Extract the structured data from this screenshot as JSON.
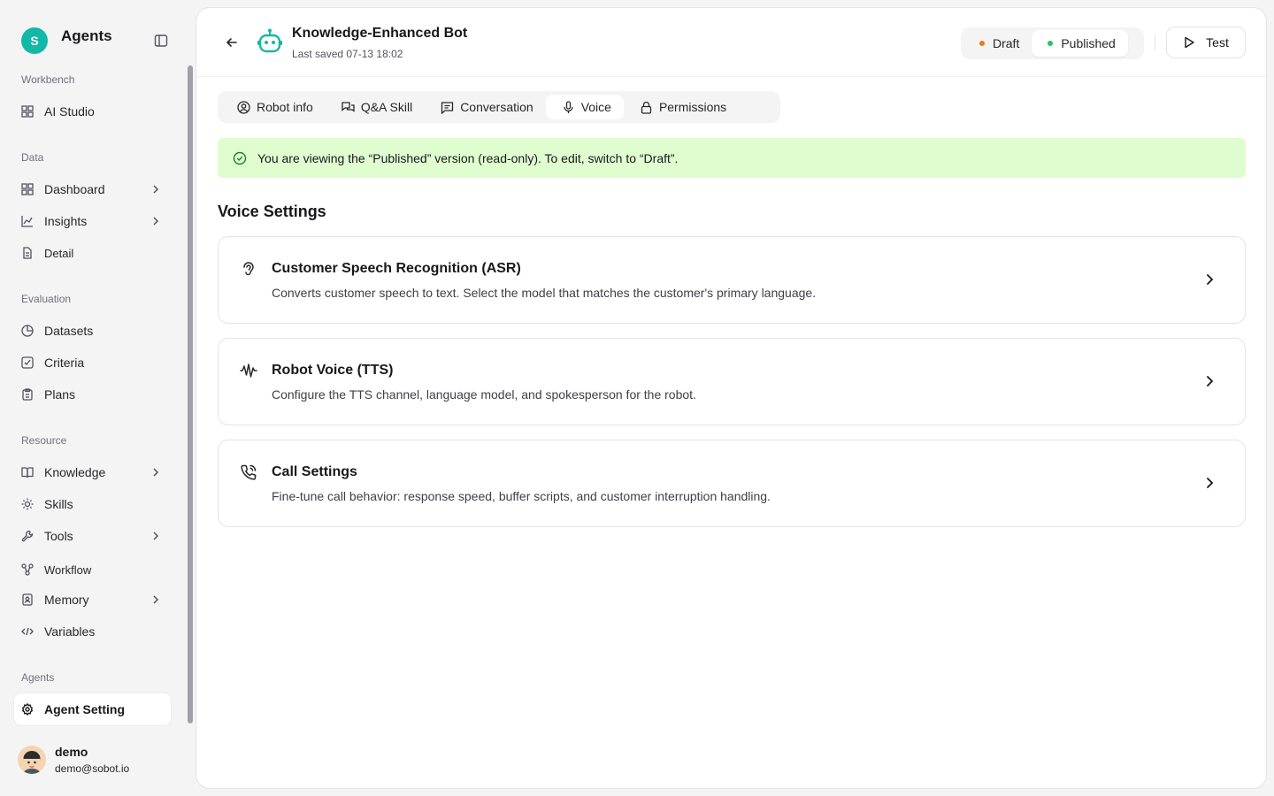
{
  "sidebar": {
    "brand_initial": "S",
    "brand_title": "Agents",
    "sections": {
      "workbench": "Workbench",
      "data": "Data",
      "evaluation": "Evaluation",
      "resource": "Resource",
      "agents": "Agents"
    },
    "items": {
      "ai_studio": "AI Studio",
      "dashboard": "Dashboard",
      "insights": "Insights",
      "detail": "Detail",
      "datasets": "Datasets",
      "criteria": "Criteria",
      "plans": "Plans",
      "knowledge": "Knowledge",
      "skills": "Skills",
      "tools": "Tools",
      "workflow": "Workflow",
      "memory": "Memory",
      "variables": "Variables",
      "agent_setting": "Agent Setting"
    },
    "user": {
      "name": "demo",
      "email": "demo@sobot.io"
    }
  },
  "header": {
    "title": "Knowledge-Enhanced Bot",
    "last_saved": "Last saved 07-13 18:02",
    "versions": [
      {
        "label": "Draft",
        "color": "#f97316"
      },
      {
        "label": "Published",
        "color": "#22c55e"
      }
    ],
    "selected_version": "Published",
    "test_label": "Test"
  },
  "tabs": [
    {
      "label": "Robot info",
      "icon": "user-circle-icon"
    },
    {
      "label": "Q&A Skill",
      "icon": "chat-bubbles-icon"
    },
    {
      "label": "Conversation",
      "icon": "message-square-icon"
    },
    {
      "label": "Voice",
      "icon": "microphone-icon",
      "active": true
    },
    {
      "label": "Permissions",
      "icon": "lock-icon"
    }
  ],
  "notice": "You are viewing the “Published” version (read-only). To edit, switch to “Draft”.",
  "section_title": "Voice Settings",
  "cards": [
    {
      "title": "Customer Speech Recognition (ASR)",
      "desc": "Converts customer speech to text. Select the model that matches the customer's primary language.",
      "icon": "ear-icon"
    },
    {
      "title": "Robot Voice (TTS)",
      "desc": "Configure the TTS channel, language model, and spokesperson for the robot.",
      "icon": "audio-waveform-icon"
    },
    {
      "title": "Call Settings",
      "desc": "Fine-tune call behavior: response speed, buffer scripts, and customer interruption handling.",
      "icon": "phone-call-icon"
    }
  ],
  "colors": {
    "accent": "#14b8a6",
    "notice_bg": "#e0fdd0",
    "notice_icon": "#15803d"
  }
}
